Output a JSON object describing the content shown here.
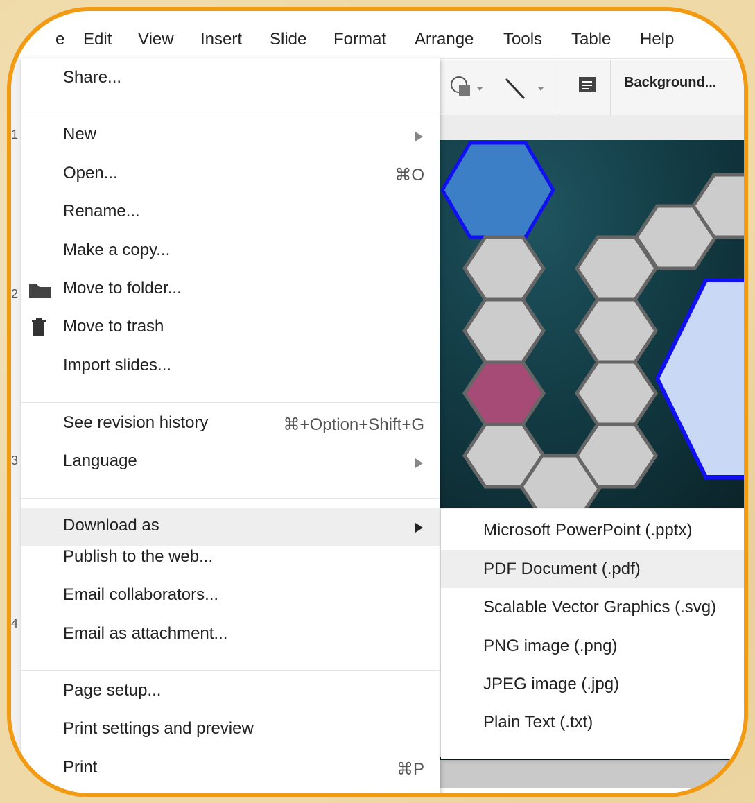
{
  "menubar": {
    "items": [
      "Edit",
      "View",
      "Insert",
      "Slide",
      "Format",
      "Arrange",
      "Tools",
      "Table",
      "Help"
    ]
  },
  "toolbar": {
    "background_label": "Background..."
  },
  "file_menu": {
    "share": "Share...",
    "new": "New",
    "open": "Open...",
    "open_shortcut": "⌘O",
    "rename": "Rename...",
    "make_copy": "Make a copy...",
    "move_to_folder": "Move to folder...",
    "move_to_trash": "Move to trash",
    "import_slides": "Import slides...",
    "revision_history": "See revision history",
    "revision_history_shortcut": "⌘+Option+Shift+G",
    "language": "Language",
    "download_as": "Download as",
    "publish": "Publish to the web...",
    "email_collaborators": "Email collaborators...",
    "email_attachment": "Email as attachment...",
    "page_setup": "Page setup...",
    "print_settings": "Print settings and preview",
    "print": "Print",
    "print_shortcut": "⌘P"
  },
  "download_submenu": {
    "items": [
      "Microsoft PowerPoint (.pptx)",
      "PDF Document (.pdf)",
      "Scalable Vector Graphics (.svg)",
      "PNG image (.png)",
      "JPEG image (.jpg)",
      "Plain Text (.txt)"
    ],
    "highlighted_index": 1
  },
  "slide_strip_numbers": [
    "1",
    "2",
    "3",
    "4"
  ],
  "colors": {
    "frame_orange": "#f39a13",
    "background_tan": "#efd9a6",
    "hexagon_blue": "#3d7fc6",
    "hexagon_pink": "#a64b75",
    "hexagon_gray": "#cccccc",
    "hexagon_light_blue": "#c9d9f5",
    "menu_highlight": "#eeeeee"
  }
}
